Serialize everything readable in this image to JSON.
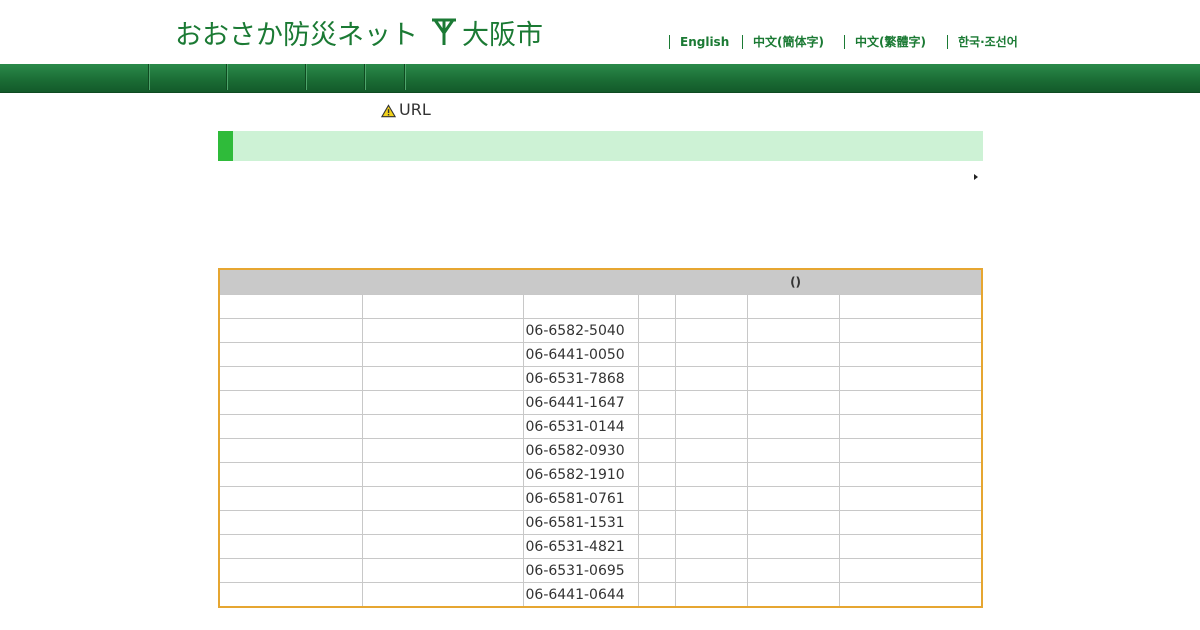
{
  "header": {
    "site_name": "おおさか防災ネット",
    "city_name": "大阪市"
  },
  "languages": [
    "English",
    "中文(簡体字)",
    "中文(繁體字)",
    "한국·조선어"
  ],
  "notice": {
    "text": "URL",
    "icon": "warning-icon"
  },
  "table": {
    "header": "()",
    "phones": [
      "",
      "06-6582-5040",
      "06-6441-0050",
      "06-6531-7868",
      "06-6441-1647",
      "06-6531-0144",
      "06-6582-0930",
      "06-6582-1910",
      "06-6581-0761",
      "06-6581-1531",
      "06-6531-4821",
      "06-6531-0695",
      "06-6441-0644"
    ]
  },
  "colors": {
    "brand_green": "#1b7a34",
    "accent_green": "#2fbb3a",
    "heading_bg": "#cdf2d5",
    "table_border": "#e6a631"
  }
}
